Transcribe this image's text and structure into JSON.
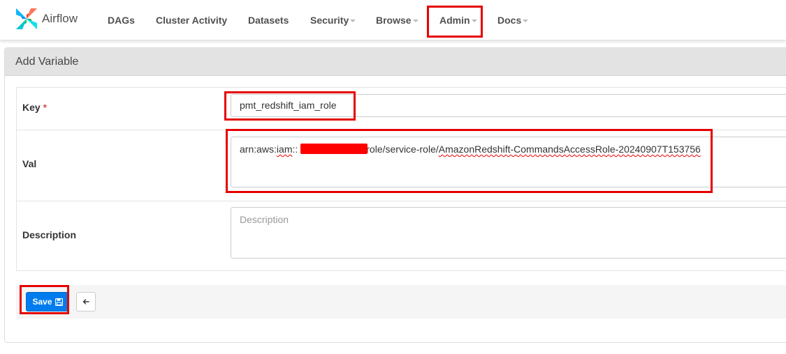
{
  "navbar": {
    "brand": "Airflow",
    "items": [
      {
        "label": "DAGs",
        "dropdown": false
      },
      {
        "label": "Cluster Activity",
        "dropdown": false
      },
      {
        "label": "Datasets",
        "dropdown": false
      },
      {
        "label": "Security",
        "dropdown": true
      },
      {
        "label": "Browse",
        "dropdown": true
      },
      {
        "label": "Admin",
        "dropdown": true
      },
      {
        "label": "Docs",
        "dropdown": true
      }
    ]
  },
  "form": {
    "title": "Add Variable",
    "key_label": "Key",
    "required_mark": "*",
    "key_value": "pmt_redshift_iam_role",
    "val_label": "Val",
    "val_prefix": "arn:aws:",
    "val_iam": "iam",
    "val_colons": "::",
    "val_middle": "role/service-role/",
    "val_suffix": "AmazonRedshift-CommandsAccessRole-20240907T153756",
    "description_label": "Description",
    "description_placeholder": "Description",
    "save_label": "Save"
  },
  "colors": {
    "primary": "#017cee",
    "highlight": "#e60000",
    "redaction": "#ff0000"
  },
  "icons": {
    "save": "floppy-disk-icon",
    "back": "arrow-left-icon",
    "logo": "airflow-pinwheel-logo"
  }
}
